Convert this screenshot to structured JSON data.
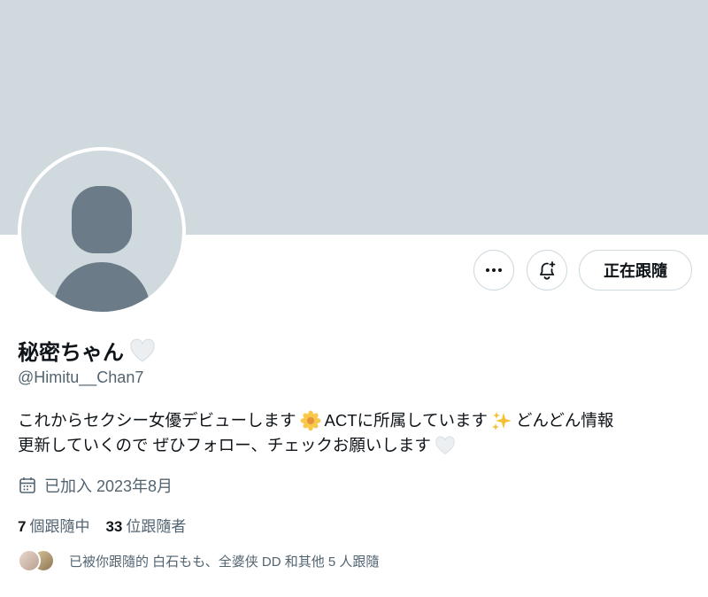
{
  "profile": {
    "display_name": "秘密ちゃん",
    "handle": "@Himitu__Chan7",
    "bio_line1_part1": "これからセクシー女優デビューします",
    "bio_line1_part2": "ACTに所属しています",
    "bio_line1_part3": "どんどん情報",
    "bio_line2": "更新していくので ぜひフォロー、チェックお願いします",
    "joined": "已加入 2023年8月"
  },
  "actions": {
    "more_icon": "ellipsis-icon",
    "notify_icon": "bell-plus-icon",
    "follow_label": "正在跟隨"
  },
  "stats": {
    "following_count": "7",
    "following_label": "個跟隨中",
    "followers_count": "33",
    "followers_label": "位跟隨者"
  },
  "followed_by": "已被你跟隨的 白石もも、全婆侠 DD 和其他 5 人跟隨",
  "colors": {
    "banner": "#cfd9de",
    "avatar_silhouette": "#6b7b87",
    "secondary_text": "#536471",
    "primary_text": "#0f1419"
  }
}
